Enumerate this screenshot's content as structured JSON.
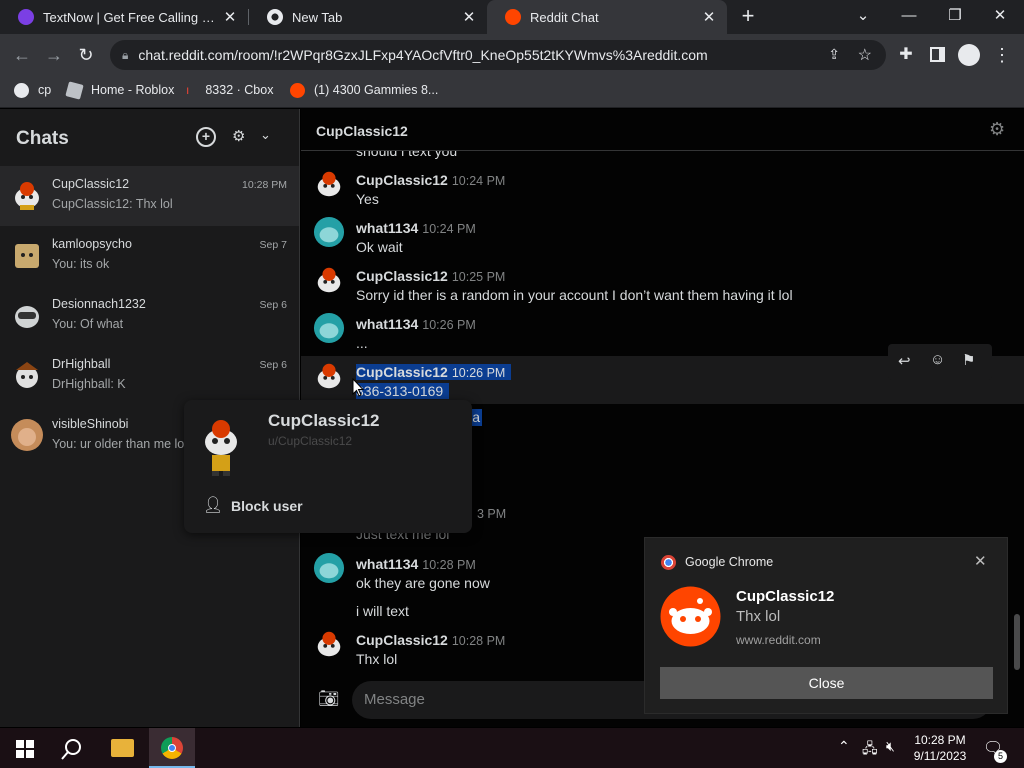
{
  "browser": {
    "tabs": [
      {
        "title": "TextNow | Get Free Calling and Te",
        "active": false
      },
      {
        "title": "New Tab",
        "active": false
      },
      {
        "title": "Reddit Chat",
        "active": true
      }
    ],
    "url": "chat.reddit.com/room/!r2WPqr8GzxJLFxp4YAOcfVftr0_KneOp55t2tKYWmvs%3Areddit.com",
    "bookmarks": [
      {
        "label": "cp"
      },
      {
        "label": "Home - Roblox"
      },
      {
        "label": "8332 · Cbox"
      },
      {
        "label": "(1) 4300 Gammies 8..."
      }
    ]
  },
  "sidebar": {
    "title": "Chats",
    "chats": [
      {
        "name": "CupClassic12",
        "preview": "CupClassic12: Thx lol",
        "date": "10:28 PM",
        "selected": true
      },
      {
        "name": "kamloopsycho",
        "preview": "You: its ok",
        "date": "Sep 7"
      },
      {
        "name": "Desionnach1232",
        "preview": "You: Of what",
        "date": "Sep 6"
      },
      {
        "name": "DrHighball",
        "preview": "DrHighball: K",
        "date": "Sep 6"
      },
      {
        "name": "visibleShinobi",
        "preview": "You: ur older than me lol",
        "date": ""
      }
    ]
  },
  "main": {
    "title": "CupClassic12",
    "clipped_top_text": "should i text you",
    "messages": [
      {
        "author": "CupClassic12",
        "time": "10:24 PM",
        "lines": [
          "Yes"
        ]
      },
      {
        "author": "what1134",
        "time": "10:24 PM",
        "lines": [
          "Ok wait"
        ]
      },
      {
        "author": "CupClassic12",
        "time": "10:25 PM",
        "lines": [
          "Sorry id ther is a random in your account I don’t want them having it lol"
        ]
      },
      {
        "author": "what1134",
        "time": "10:26 PM",
        "lines": [
          "..."
        ]
      },
      {
        "author": "CupClassic12",
        "time": "10:26 PM",
        "lines": [
          "336-313-0169"
        ],
        "selected": true
      },
      {
        "author": "",
        "time": "3 PM",
        "lines": [
          "Just text me lol"
        ],
        "partial": true
      },
      {
        "author": "what1134",
        "time": "10:28 PM",
        "lines": [
          "ok they are gone now",
          "i will text"
        ]
      },
      {
        "author": "CupClassic12",
        "time": "10:28 PM",
        "lines": [
          "Thx lol"
        ]
      }
    ],
    "hidden_fragment": "a",
    "composer_placeholder": "Message"
  },
  "popover": {
    "username": "CupClassic12",
    "handle": "u/CupClassic12",
    "block_label": "Block user"
  },
  "notification": {
    "app": "Google Chrome",
    "title": "CupClassic12",
    "message": "Thx lol",
    "source": "www.reddit.com",
    "close_label": "Close"
  },
  "taskbar": {
    "time": "10:28 PM",
    "date": "9/11/2023",
    "notification_count": "5"
  },
  "colors": {
    "reddit_orange": "#ff4500",
    "selection": "#0b3d91",
    "chrome_dark": "#202124"
  }
}
